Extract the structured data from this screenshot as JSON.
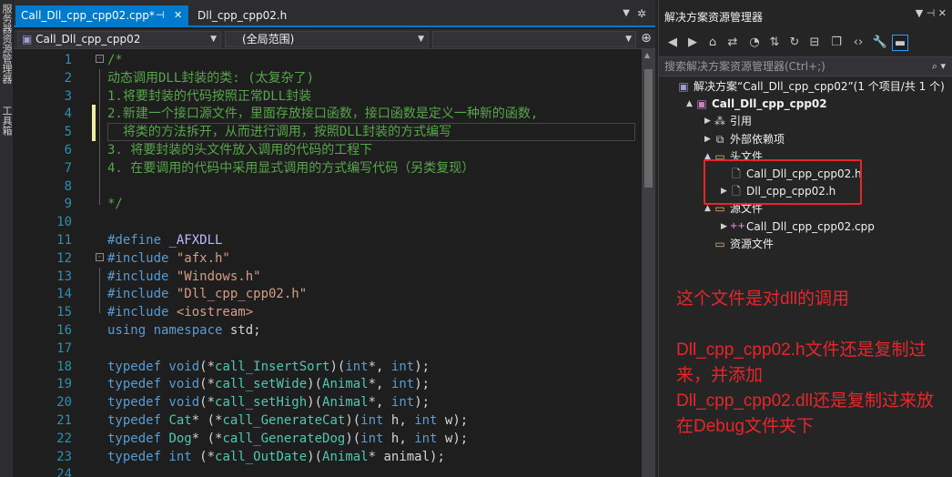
{
  "left_strip": {
    "items": [
      "服务器资源管理器",
      "工具箱"
    ]
  },
  "tabs": [
    {
      "label": "Call_Dll_cpp_cpp02.cpp*",
      "active": true
    },
    {
      "label": "Dll_cpp_cpp02.h",
      "active": false
    }
  ],
  "navbar": {
    "project_combo": "Call_Dll_cpp_cpp02",
    "scope_combo": "(全局范围)",
    "member_combo": ""
  },
  "code_lines": [
    {
      "n": "1",
      "parts": [
        [
          "cmt",
          "/*"
        ]
      ]
    },
    {
      "n": "2",
      "parts": [
        [
          "cmt",
          "动态调用DLL封装的类: (太复杂了)"
        ]
      ]
    },
    {
      "n": "3",
      "parts": [
        [
          "cmt",
          "1.将要封装的代码按照正常DLL封装"
        ]
      ]
    },
    {
      "n": "4",
      "parts": [
        [
          "cmt",
          "2.新建一个接口源文件，里面存放接口函数，接口函数是定义一种新的函数,"
        ]
      ]
    },
    {
      "n": "5",
      "parts": [
        [
          "cmt",
          "  将类的方法拆开，从而进行调用，按照DLL封装的方式编写"
        ]
      ]
    },
    {
      "n": "6",
      "parts": [
        [
          "cmt",
          "3. 将要封装的头文件放入调用的代码的工程下"
        ]
      ]
    },
    {
      "n": "7",
      "parts": [
        [
          "cmt",
          "4. 在要调用的代码中采用显式调用的方式编写代码（另类复现）"
        ]
      ]
    },
    {
      "n": "8",
      "parts": [
        [
          "cmt",
          ""
        ]
      ]
    },
    {
      "n": "9",
      "parts": [
        [
          "cmt",
          "*/"
        ]
      ]
    },
    {
      "n": "10",
      "parts": []
    },
    {
      "n": "11",
      "parts": [
        [
          "kw",
          "#define "
        ],
        [
          "macro",
          "_AFXDLL"
        ]
      ]
    },
    {
      "n": "12",
      "parts": [
        [
          "kw",
          "#include "
        ],
        [
          "str",
          "\"afx.h\""
        ]
      ]
    },
    {
      "n": "13",
      "parts": [
        [
          "kw",
          "#include "
        ],
        [
          "str",
          "\"Windows.h\""
        ]
      ]
    },
    {
      "n": "14",
      "parts": [
        [
          "kw",
          "#include "
        ],
        [
          "str",
          "\"Dll_cpp_cpp02.h\""
        ]
      ]
    },
    {
      "n": "15",
      "parts": [
        [
          "kw",
          "#include "
        ],
        [
          "str",
          "<iostream>"
        ]
      ]
    },
    {
      "n": "16",
      "parts": [
        [
          "kw",
          "using namespace "
        ],
        [
          "nm",
          "std;"
        ]
      ]
    },
    {
      "n": "17",
      "parts": []
    },
    {
      "n": "18",
      "parts": [
        [
          "kw",
          "typedef void"
        ],
        [
          "nm",
          "(*"
        ],
        [
          "ty",
          "call_InsertSort"
        ],
        [
          "nm",
          ")("
        ],
        [
          "kw",
          "int"
        ],
        [
          "nm",
          "*, "
        ],
        [
          "kw",
          "int"
        ],
        [
          "nm",
          ");"
        ]
      ]
    },
    {
      "n": "19",
      "parts": [
        [
          "kw",
          "typedef void"
        ],
        [
          "nm",
          "(*"
        ],
        [
          "ty",
          "call_setWide"
        ],
        [
          "nm",
          ")("
        ],
        [
          "ty",
          "Animal"
        ],
        [
          "nm",
          "*, "
        ],
        [
          "kw",
          "int"
        ],
        [
          "nm",
          ");"
        ]
      ]
    },
    {
      "n": "20",
      "parts": [
        [
          "kw",
          "typedef void"
        ],
        [
          "nm",
          "(*"
        ],
        [
          "ty",
          "call_setHigh"
        ],
        [
          "nm",
          ")("
        ],
        [
          "ty",
          "Animal"
        ],
        [
          "nm",
          "*, "
        ],
        [
          "kw",
          "int"
        ],
        [
          "nm",
          ");"
        ]
      ]
    },
    {
      "n": "21",
      "parts": [
        [
          "kw",
          "typedef "
        ],
        [
          "ty",
          "Cat"
        ],
        [
          "nm",
          "* (*"
        ],
        [
          "ty",
          "call_GenerateCat"
        ],
        [
          "nm",
          ")("
        ],
        [
          "kw",
          "int"
        ],
        [
          "nm",
          " h, "
        ],
        [
          "kw",
          "int"
        ],
        [
          "nm",
          " w);"
        ]
      ]
    },
    {
      "n": "22",
      "parts": [
        [
          "kw",
          "typedef "
        ],
        [
          "ty",
          "Dog"
        ],
        [
          "nm",
          "* (*"
        ],
        [
          "ty",
          "call_GenerateDog"
        ],
        [
          "nm",
          ")("
        ],
        [
          "kw",
          "int"
        ],
        [
          "nm",
          " h, "
        ],
        [
          "kw",
          "int"
        ],
        [
          "nm",
          " w);"
        ]
      ]
    },
    {
      "n": "23",
      "parts": [
        [
          "kw",
          "typedef int "
        ],
        [
          "nm",
          "(*"
        ],
        [
          "ty",
          "call_OutDate"
        ],
        [
          "nm",
          ")("
        ],
        [
          "ty",
          "Animal"
        ],
        [
          "nm",
          "* animal);"
        ]
      ]
    },
    {
      "n": "24",
      "parts": []
    }
  ],
  "solution_explorer": {
    "title": "解决方案资源管理器",
    "search_placeholder": "搜索解决方案资源管理器(Ctrl+;)",
    "tree": [
      {
        "label": "解决方案“Call_Dll_cpp_cpp02”(1 个项目/共 1 个)",
        "icon": "solution-icon",
        "indent": 0,
        "toggle": "",
        "bold": false
      },
      {
        "label": "Call_Dll_cpp_cpp02",
        "icon": "project-icon",
        "indent": 1,
        "toggle": "▲",
        "bold": true
      },
      {
        "label": "引用",
        "icon": "references-icon",
        "indent": 2,
        "toggle": "▶",
        "bold": false
      },
      {
        "label": "外部依赖项",
        "icon": "external-deps-icon",
        "indent": 2,
        "toggle": "▶",
        "bold": false
      },
      {
        "label": "头文件",
        "icon": "filter-folder-icon",
        "indent": 2,
        "toggle": "▲",
        "bold": false
      },
      {
        "label": "Call_Dll_cpp_cpp02.h",
        "icon": "header-file-icon",
        "indent": 3,
        "toggle": "",
        "bold": false
      },
      {
        "label": "Dll_cpp_cpp02.h",
        "icon": "header-file-icon",
        "indent": 3,
        "toggle": "▶",
        "bold": false
      },
      {
        "label": "源文件",
        "icon": "filter-folder-icon",
        "indent": 2,
        "toggle": "▲",
        "bold": false
      },
      {
        "label": "Call_Dll_cpp_cpp02.cpp",
        "icon": "cpp-file-icon",
        "indent": 3,
        "toggle": "▶",
        "bold": false
      },
      {
        "label": "资源文件",
        "icon": "filter-folder-icon",
        "indent": 2,
        "toggle": "",
        "bold": false
      }
    ]
  },
  "annotations": [
    "这个文件是对dll的调用",
    "Dll_cpp_cpp02.h文件还是复制过来，并添加",
    "Dll_cpp_cpp02.dll还是复制过来放在Debug文件夹下"
  ],
  "colors": {
    "accent": "#007acc",
    "annotation": "#e8262a",
    "comment": "#57a64a",
    "keyword": "#569cd6",
    "string": "#d69d85",
    "type": "#4ec9b0"
  }
}
